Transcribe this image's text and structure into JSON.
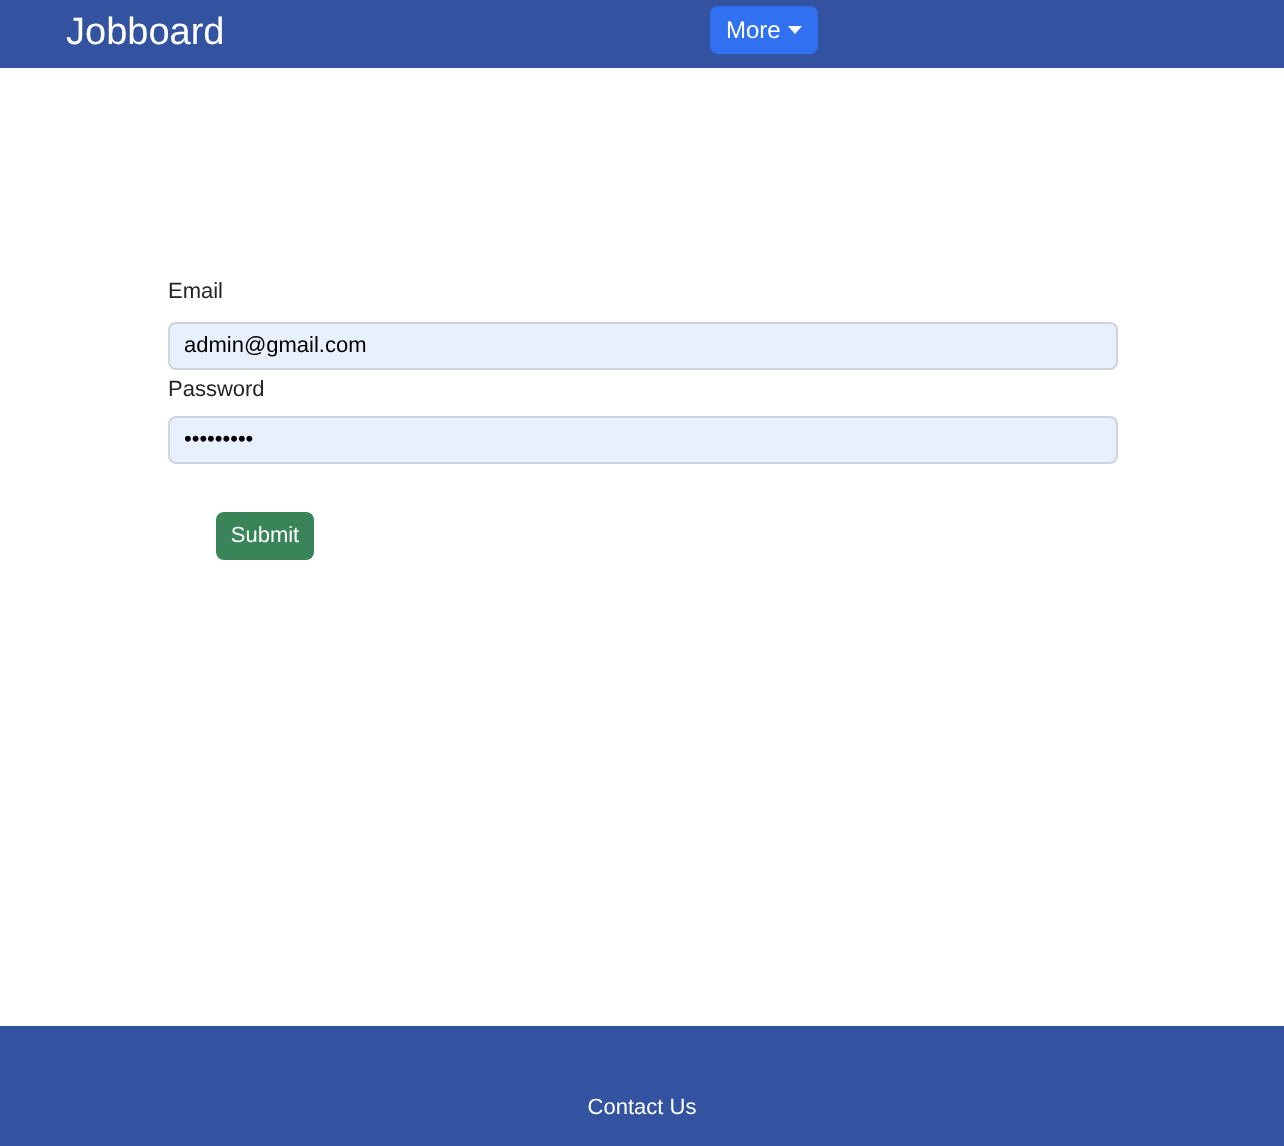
{
  "navbar": {
    "brand": "Jobboard",
    "menu_button": "More"
  },
  "form": {
    "fields": [
      {
        "label": "Email",
        "value": "admin@gmail.com"
      },
      {
        "label": "Password",
        "value": "•••••••••"
      }
    ],
    "submit": "Submit"
  },
  "footer": {
    "link": "Contact Us"
  }
}
